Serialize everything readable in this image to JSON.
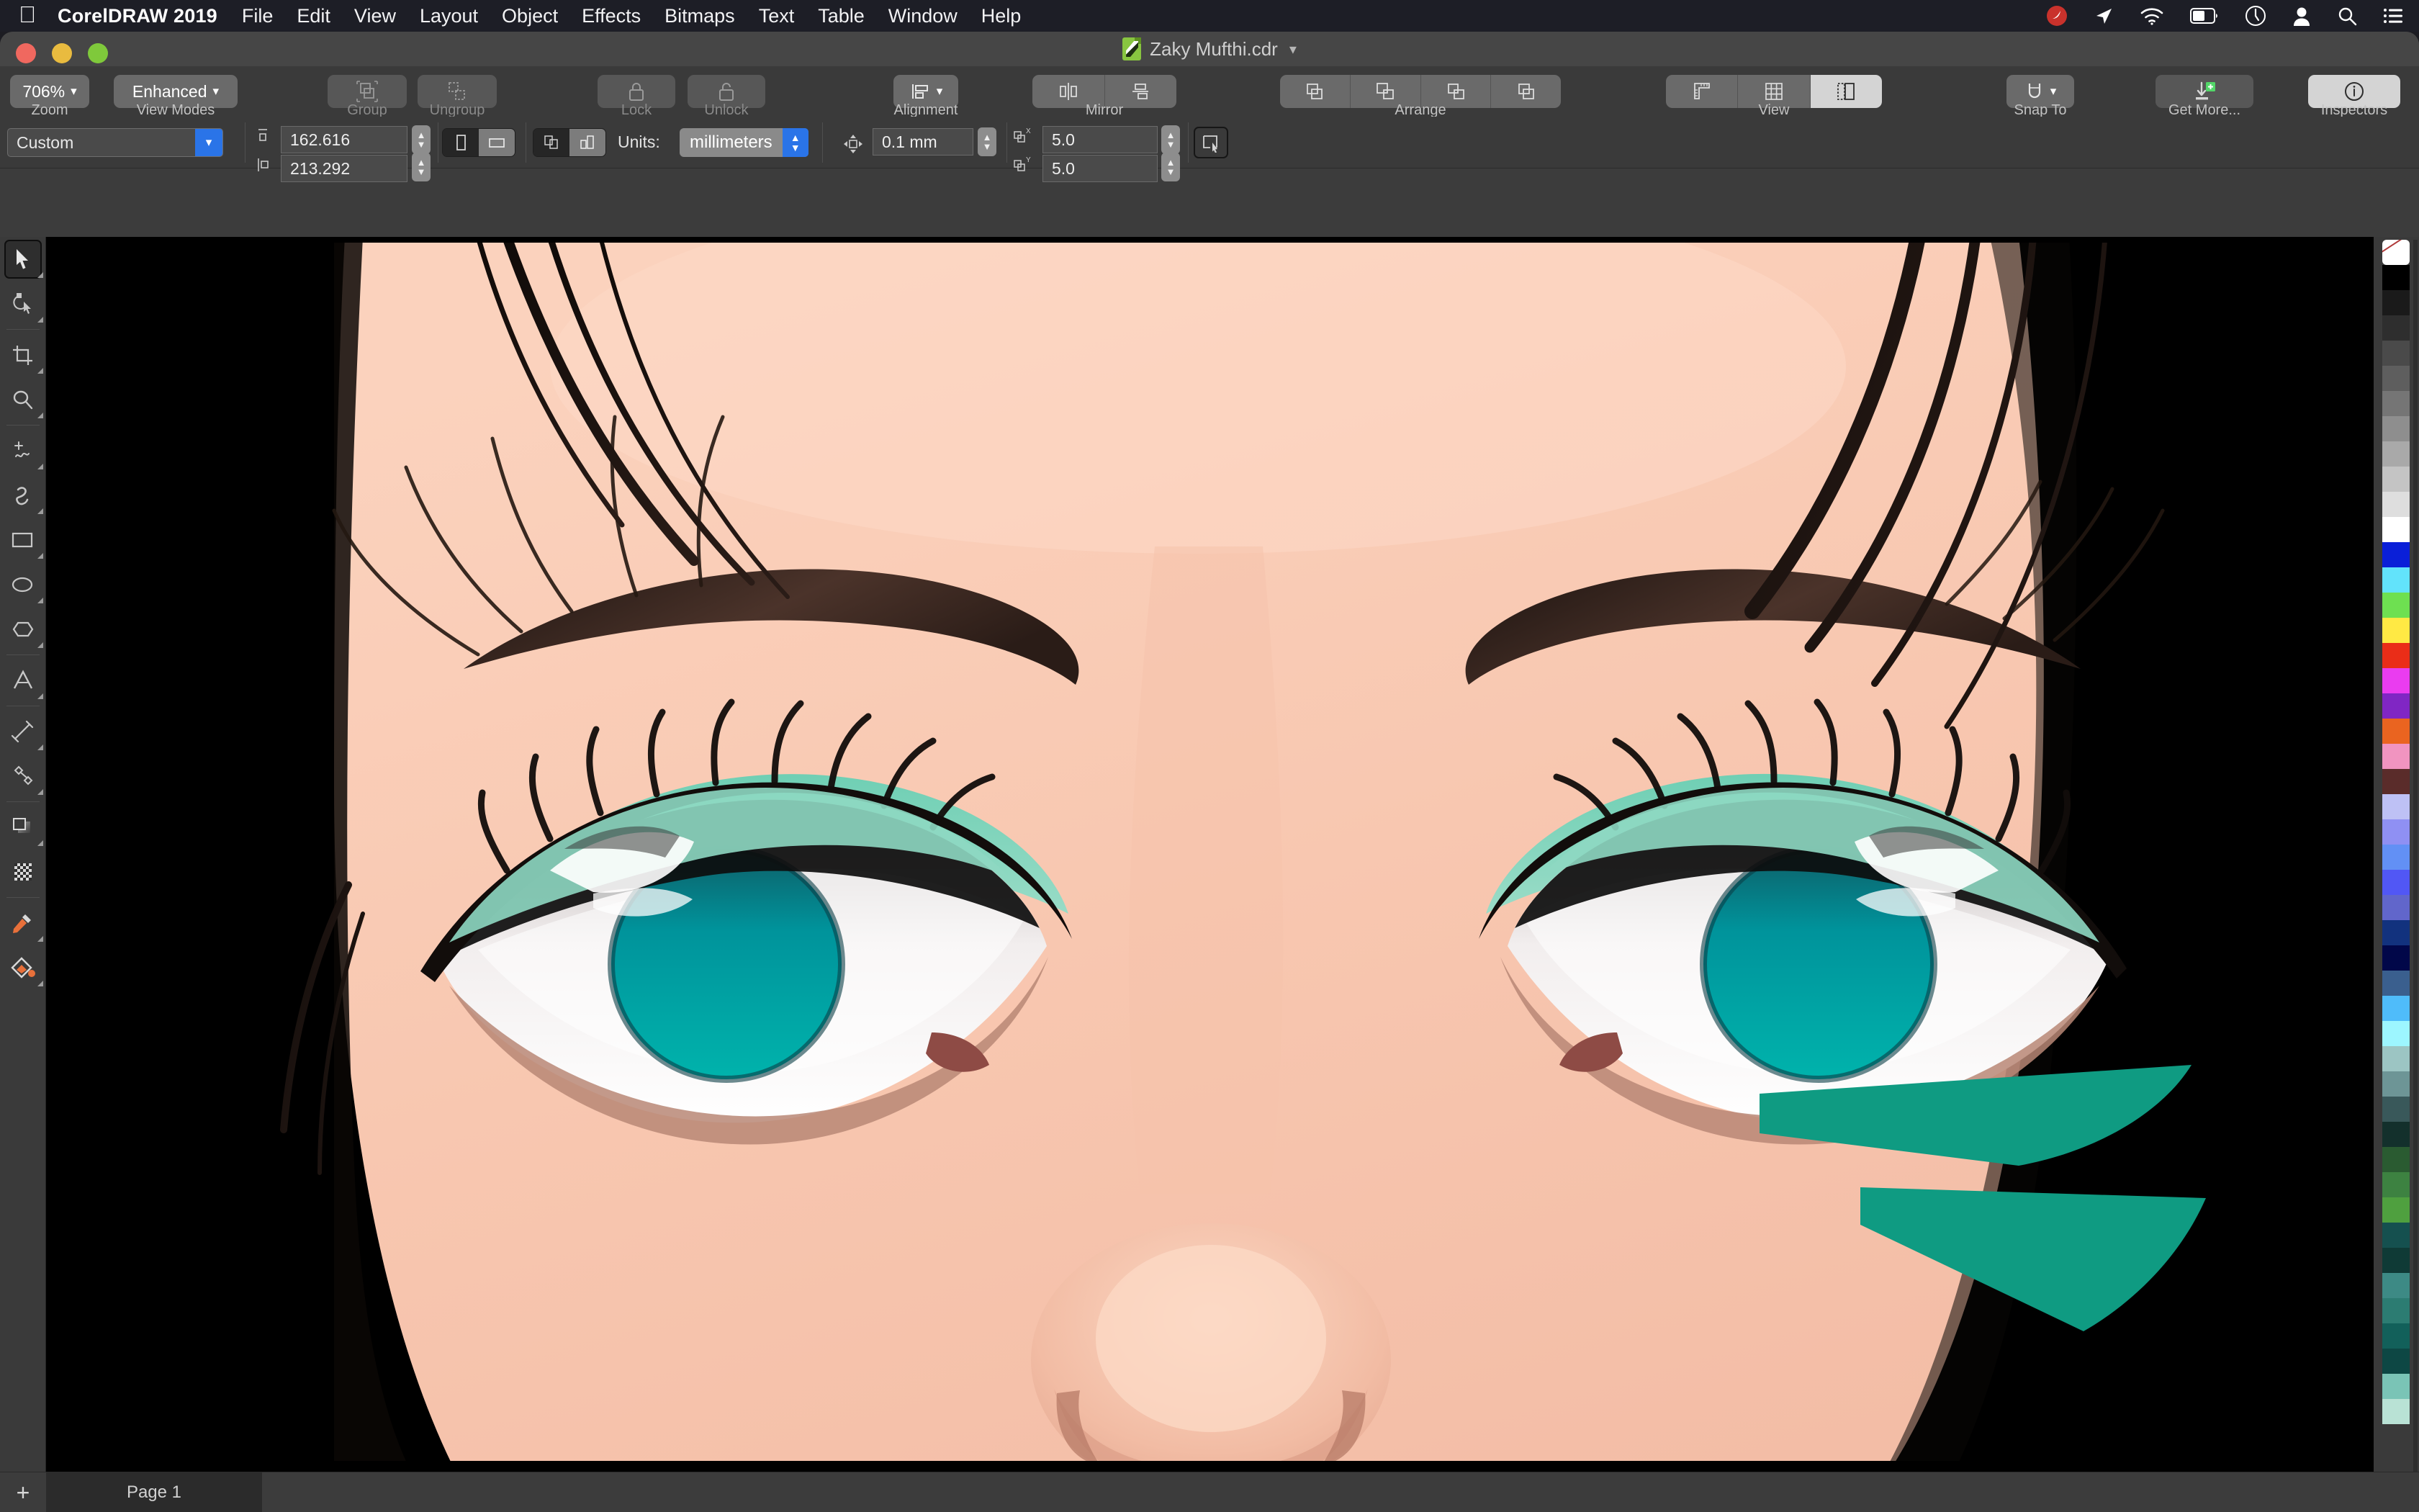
{
  "menubar": {
    "apple_icon": "apple-logo",
    "app_name": "CorelDRAW 2019",
    "items": [
      "File",
      "Edit",
      "View",
      "Layout",
      "Object",
      "Effects",
      "Bitmaps",
      "Text",
      "Table",
      "Window",
      "Help"
    ],
    "status_icons": [
      "corel-tray-icon",
      "location-arrow-icon",
      "wifi-icon",
      "battery-icon",
      "time-machine-icon",
      "user-account-icon",
      "spotlight-search-icon",
      "control-center-icon"
    ]
  },
  "window": {
    "traffic_lights": [
      "close",
      "minimize",
      "zoom"
    ],
    "document_title": "Zaky Mufthi.cdr",
    "document_icon": "corel-document-icon",
    "title_chevron": "chevron-down-icon"
  },
  "ribbon": {
    "zoom": {
      "value": "706%",
      "label": "Zoom",
      "chevron": "chevron-down-icon"
    },
    "view_modes": {
      "value": "Enhanced",
      "label": "View Modes",
      "chevron": "chevron-down-icon"
    },
    "group": {
      "label": "Group",
      "icon": "group-icon",
      "enabled": false
    },
    "ungroup": {
      "label": "Ungroup",
      "icon": "ungroup-icon",
      "enabled": false
    },
    "lock": {
      "label": "Lock",
      "icon": "lock-icon",
      "enabled": false
    },
    "unlock": {
      "label": "Unlock",
      "icon": "unlock-icon",
      "enabled": false
    },
    "alignment": {
      "label": "Alignment",
      "icon": "align-left-icon",
      "chevron": "chevron-down-icon"
    },
    "mirror": {
      "label": "Mirror",
      "icons": [
        "mirror-horizontal-icon",
        "mirror-vertical-icon"
      ]
    },
    "arrange": {
      "label": "Arrange",
      "icons": [
        "to-front-icon",
        "forward-one-icon",
        "back-one-icon",
        "to-back-icon"
      ]
    },
    "view": {
      "label": "View",
      "icons": [
        "rulers-icon",
        "grid-icon",
        "page-border-icon"
      ],
      "active_index": 2
    },
    "snap_to": {
      "label": "Snap To",
      "icon": "magnet-icon",
      "chevron": "chevron-down-icon"
    },
    "get_more": {
      "label": "Get More...",
      "icon": "download-plus-icon"
    },
    "inspectors": {
      "label": "Inspectors",
      "icon": "info-circle-icon",
      "active": true
    }
  },
  "propertybar": {
    "page_preset": {
      "value": "Custom",
      "chevron": "chevron-down-icon"
    },
    "page_width": {
      "value": "162.616",
      "icon": "page-width-icon"
    },
    "page_height": {
      "value": "213.292",
      "icon": "page-height-icon"
    },
    "orientation": {
      "icons": [
        "portrait-icon",
        "landscape-icon"
      ],
      "active_index": 1
    },
    "page_scope": {
      "icons": [
        "all-pages-icon",
        "current-page-icon"
      ],
      "active_index": 1
    },
    "units_label": "Units:",
    "units": {
      "value": "millimeters",
      "stepper": "stepper-icon"
    },
    "nudge": {
      "value": "0.1 mm",
      "icon": "nudge-icon"
    },
    "duplicate_x": {
      "value": "5.0",
      "icon": "duplicate-x-icon"
    },
    "duplicate_y": {
      "value": "5.0",
      "icon": "duplicate-y-icon"
    },
    "edit_page_button": {
      "icon": "edit-page-icon"
    }
  },
  "toolbox": [
    {
      "name": "pick-tool",
      "icon": "arrow-cursor-icon",
      "selected": true,
      "flyout": true
    },
    {
      "name": "shape-tool",
      "icon": "shape-edit-icon",
      "selected": false,
      "flyout": true
    },
    {
      "name": "crop-tool",
      "icon": "crop-icon",
      "selected": false,
      "flyout": true
    },
    {
      "name": "zoom-tool",
      "icon": "magnifier-icon",
      "selected": false,
      "flyout": true
    },
    {
      "name": "freehand-tool",
      "icon": "freehand-curve-icon",
      "selected": false,
      "flyout": true
    },
    {
      "name": "artistic-media-tool",
      "icon": "artistic-media-icon",
      "selected": false,
      "flyout": true
    },
    {
      "name": "rectangle-tool",
      "icon": "rectangle-icon",
      "selected": false,
      "flyout": true
    },
    {
      "name": "ellipse-tool",
      "icon": "ellipse-icon",
      "selected": false,
      "flyout": true
    },
    {
      "name": "polygon-tool",
      "icon": "polygon-icon",
      "selected": false,
      "flyout": true
    },
    {
      "name": "text-tool",
      "icon": "text-a-icon",
      "selected": false,
      "flyout": true
    },
    {
      "name": "dimension-tool",
      "icon": "dimension-line-icon",
      "selected": false,
      "flyout": true
    },
    {
      "name": "connector-tool",
      "icon": "connector-icon",
      "selected": false,
      "flyout": true
    },
    {
      "name": "drop-shadow-tool",
      "icon": "drop-shadow-icon",
      "selected": false,
      "flyout": true
    },
    {
      "name": "transparency-tool",
      "icon": "transparency-checker-icon",
      "selected": false,
      "flyout": false
    },
    {
      "name": "color-eyedropper-tool",
      "icon": "eyedropper-icon",
      "selected": false,
      "flyout": true
    },
    {
      "name": "interactive-fill-tool",
      "icon": "fill-icon",
      "selected": false,
      "flyout": true
    }
  ],
  "palette": {
    "scrollbar": "palette-scrollbar",
    "swatches": [
      "none",
      "#000000",
      "#1a1a1a",
      "#2e2e2e",
      "#4a4a4a",
      "#5e5e5e",
      "#757575",
      "#8e8e8e",
      "#a9a9a9",
      "#c4c4c4",
      "#dedede",
      "#ffffff",
      "#0a1fd8",
      "#62e3fb",
      "#6ee051",
      "#ffe944",
      "#ea2d18",
      "#ea3cf0",
      "#8026c4",
      "#ea6420",
      "#f194c0",
      "#5a2c2a",
      "#bec1f5",
      "#8f90f3",
      "#6290f5",
      "#5157f5",
      "#6166cb",
      "#12327e",
      "#010749",
      "#3a5f8e",
      "#4fbcfa",
      "#9df6ff",
      "#9cc5c3",
      "#6d9596",
      "#39585a",
      "#13302c",
      "#2a5b31",
      "#3d8241",
      "#4fa03f",
      "#15504f",
      "#0f3a36",
      "#3d8a85",
      "#2c7c72",
      "#12605a",
      "#0d4744",
      "#7ac4b6",
      "#b9e2d5"
    ]
  },
  "pagebar": {
    "add_page_icon": "plus-icon",
    "pages": [
      "Page 1"
    ],
    "active_page_index": 0
  },
  "canvas": {
    "artwork_title": "vector portrait illustration of a face - eyes, eyebrows and nose close-up",
    "background_color": "#000000",
    "skin_color": "#f8c9b2",
    "eyeshadow_color": "#8ed8c2",
    "iris_color": "#00a3a6",
    "accent_shape_color": "#0f9b82"
  }
}
